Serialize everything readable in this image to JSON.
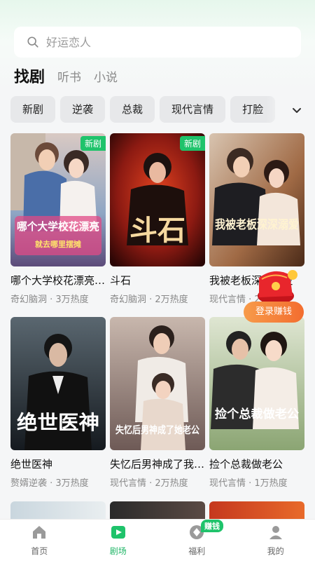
{
  "search": {
    "placeholder": "好运恋人"
  },
  "top_tabs": [
    {
      "label": "找剧",
      "active": true
    },
    {
      "label": "听书",
      "active": false
    },
    {
      "label": "小说",
      "active": false
    }
  ],
  "categories": [
    "新剧",
    "逆袭",
    "总裁",
    "现代言情",
    "打脸"
  ],
  "cards": [
    {
      "title": "哪个大学校花漂亮就去哪里摆摊",
      "meta": "奇幻脑洞 · 3万热度",
      "badge": "新剧",
      "poster_text": "哪个大学校花漂亮",
      "poster_sub": "就去哪里摆摊"
    },
    {
      "title": "斗石",
      "meta": "奇幻脑洞 · 2万热度",
      "badge": "新剧",
      "poster_text": "斗石"
    },
    {
      "title": "我被老板深深溺爱",
      "meta": "现代言情 · 2万热度",
      "poster_text": "我被老板深深溺爱"
    },
    {
      "title": "绝世医神",
      "meta": "赘婿逆袭 · 3万热度",
      "poster_text": "绝世医神"
    },
    {
      "title": "失忆后男神成了我老公",
      "meta": "现代言情 · 2万热度",
      "poster_text": "失忆后男神成了她老公"
    },
    {
      "title": "捡个总裁做老公",
      "meta": "现代言情 · 1万热度",
      "poster_text": "捡个总裁做老公"
    }
  ],
  "float_button": {
    "label": "登录赚钱"
  },
  "bottom_nav": [
    {
      "label": "首页",
      "icon": "home-icon",
      "active": false
    },
    {
      "label": "剧场",
      "icon": "play-icon",
      "active": true
    },
    {
      "label": "福利",
      "icon": "coin-icon",
      "active": false,
      "badge": "赚钱"
    },
    {
      "label": "我的",
      "icon": "user-icon",
      "active": false
    }
  ],
  "colors": {
    "accent": "#1fc36b",
    "float_orange": "#f36d2f"
  }
}
